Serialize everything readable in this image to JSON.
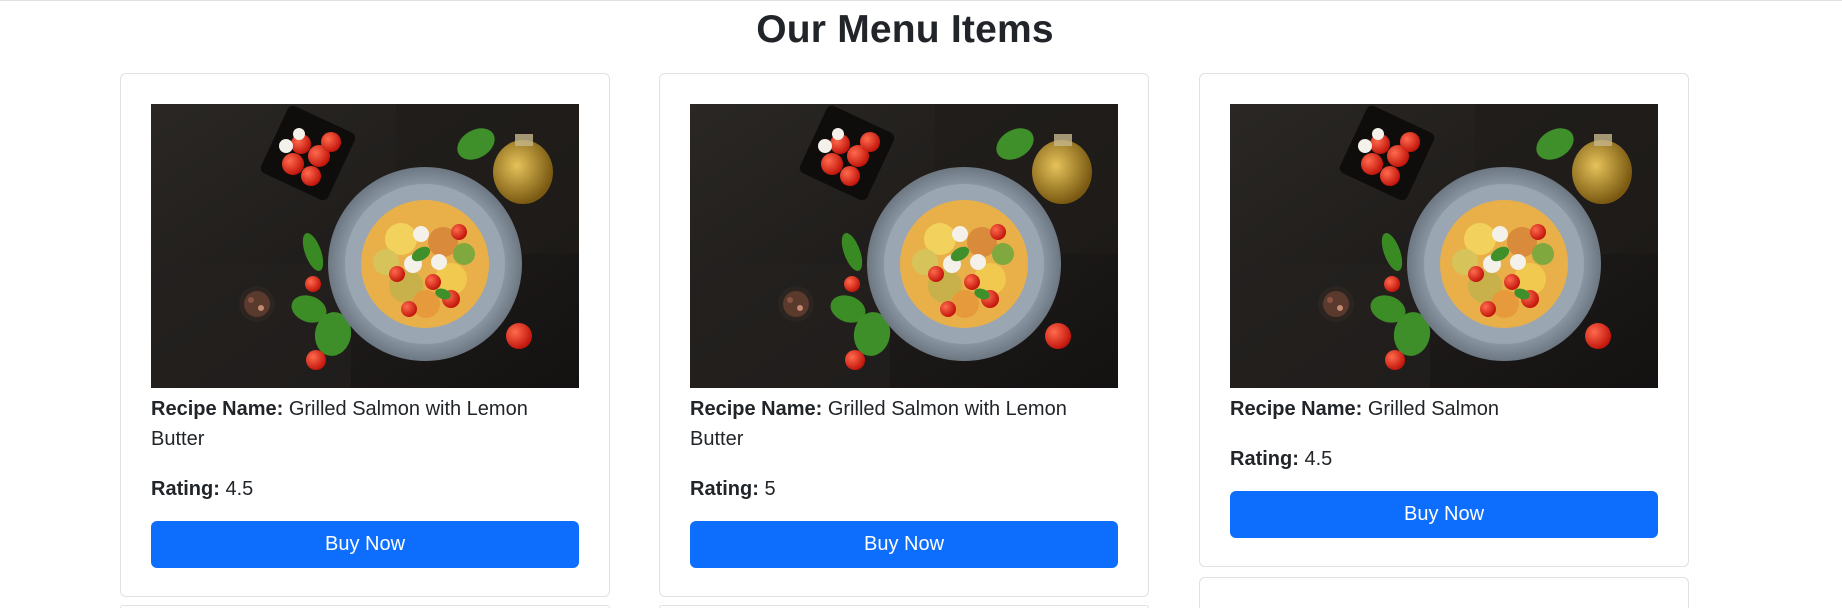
{
  "page": {
    "title": "Our Menu Items"
  },
  "labels": {
    "recipe_name": "Recipe Name:",
    "rating": "Rating:"
  },
  "cards": [
    {
      "recipe_name": "Grilled Salmon with Lemon Butter",
      "rating": "4.5",
      "button_label": "Buy Now"
    },
    {
      "recipe_name": "Grilled Salmon with Lemon Butter",
      "rating": "5",
      "button_label": "Buy Now"
    },
    {
      "recipe_name": "Grilled Salmon",
      "rating": "4.5",
      "button_label": "Buy Now"
    }
  ],
  "colors": {
    "button": "#0d6efd",
    "card_border": "#dfe1e4",
    "text": "#212529"
  },
  "icons": {
    "food_image": "pasta-dish-photo"
  }
}
